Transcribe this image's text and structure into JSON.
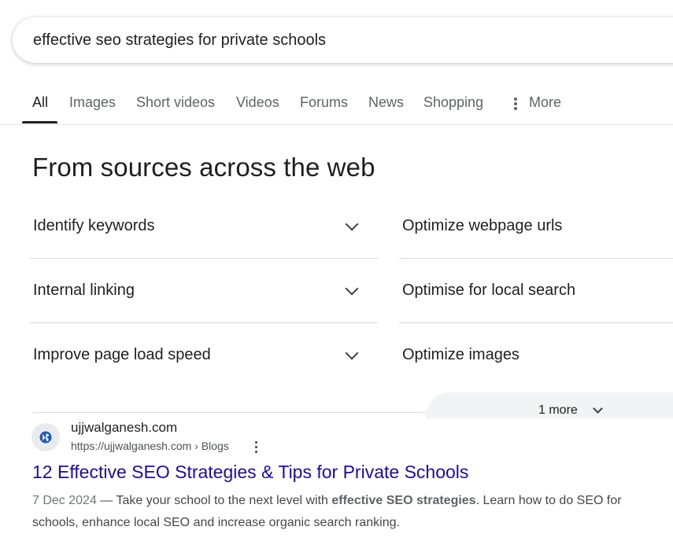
{
  "search": {
    "query": "effective seo strategies for private schools"
  },
  "tabs": [
    {
      "label": "All",
      "active": true
    },
    {
      "label": "Images"
    },
    {
      "label": "Short videos"
    },
    {
      "label": "Videos"
    },
    {
      "label": "Forums"
    },
    {
      "label": "News"
    },
    {
      "label": "Shopping"
    },
    {
      "label": "More"
    }
  ],
  "sources": {
    "heading": "From sources across the web",
    "left_items": [
      "Identify keywords",
      "Internal linking",
      "Improve page load speed"
    ],
    "right_items": [
      "Optimize webpage urls",
      "Optimise for local search",
      "Optimize images"
    ],
    "more_label": "1 more"
  },
  "result": {
    "site_name": "ujjwalganesh.com",
    "url": "https://ujjwalganesh.com › Blogs",
    "title": "12 Effective SEO Strategies & Tips for Private Schools",
    "date": "7 Dec 2024",
    "snippet_pre": " — Take your school to the next level with ",
    "snippet_bold1": "effective",
    "snippet_bold2": "SEO strategies",
    "snippet_post": ". Learn how to do SEO for schools, enhance local SEO and increase organic search ranking."
  },
  "colors": {
    "link": "#1a0dab",
    "divider": "#dadce0",
    "pill": "#f1f3f4"
  }
}
